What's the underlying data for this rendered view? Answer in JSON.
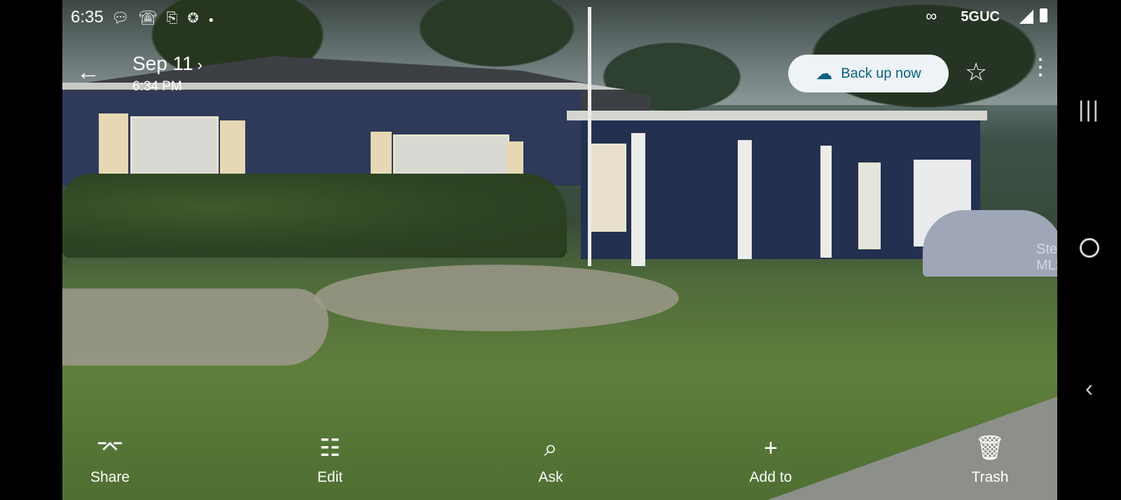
{
  "status_bar": {
    "time": "6:35",
    "left_icons": [
      "chat-icon",
      "phone-icon",
      "clipboard-icon",
      "tag-icon",
      "dot-icon"
    ],
    "network": "5GUC"
  },
  "header": {
    "date": "Sep 11",
    "time": "6:34 PM",
    "backup_label": "Back up now"
  },
  "watermark": "Stellar MLS",
  "toolbar": {
    "share": "Share",
    "edit": "Edit",
    "ask": "Ask",
    "add_to": "Add to",
    "trash": "Trash"
  },
  "colors": {
    "backup_bg": "#eef3f7",
    "backup_text": "#0b5f7d"
  }
}
